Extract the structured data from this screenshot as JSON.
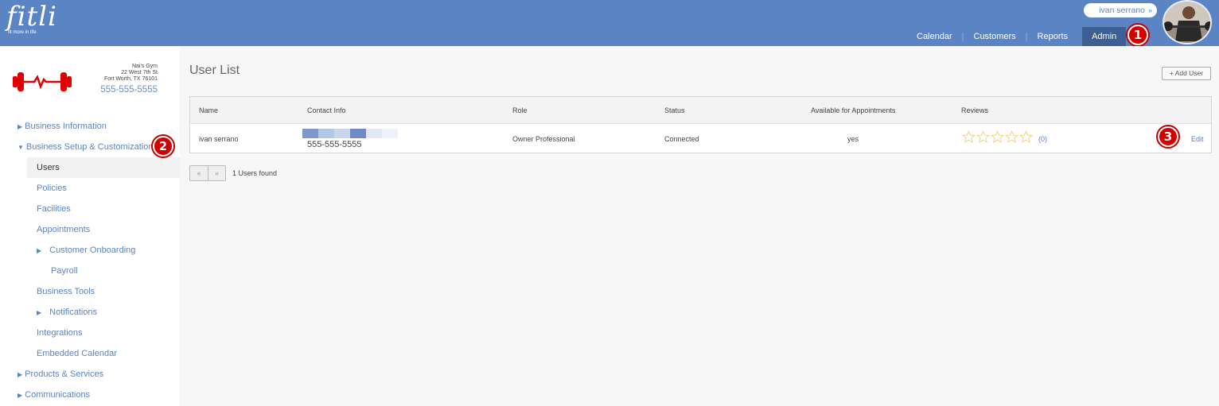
{
  "brand": {
    "logo": "fitli",
    "tagline": "fit more in life",
    "header_color": "#5b84c4",
    "active_nav_color": "#3e5f94"
  },
  "user_menu": {
    "name": "ivan serrano",
    "chevron": "»"
  },
  "nav": [
    {
      "label": "Calendar"
    },
    {
      "label": "Customers"
    },
    {
      "label": "Reports"
    },
    {
      "label": "Admin",
      "active": true
    }
  ],
  "callouts": [
    "1",
    "2",
    "3"
  ],
  "business": {
    "name": "Nai's Gym",
    "street": "22 West 7th St",
    "city": "Fort Worth, TX 76101",
    "phone": "555-555-5555",
    "logo_icon": "dumbbell-heartbeat-icon"
  },
  "sidebar": {
    "items": [
      {
        "label": "Business Information",
        "expand": "▶"
      },
      {
        "label": "Business Setup & Customization",
        "expand": "▼"
      },
      {
        "label": "Users",
        "active": true
      },
      {
        "label": "Policies"
      },
      {
        "label": "Facilities"
      },
      {
        "label": "Appointments"
      },
      {
        "label": "Customer Onboarding",
        "expand": "▶"
      },
      {
        "label": "Payroll"
      },
      {
        "label": "Business Tools"
      },
      {
        "label": "Notifications",
        "expand": "▶"
      },
      {
        "label": "Integrations"
      },
      {
        "label": "Embedded Calendar"
      },
      {
        "label": "Products & Services",
        "expand": "▶"
      },
      {
        "label": "Communications",
        "expand": "▶"
      }
    ]
  },
  "main": {
    "title": "User List",
    "add_user_label": "+ Add User",
    "table": {
      "columns": [
        "Name",
        "Contact Info",
        "Role",
        "Status",
        "Available for Appointments",
        "Reviews"
      ],
      "rows": [
        {
          "name": "ivan serrano",
          "contact_phone": "555-555-5555",
          "role": "Owner Professional",
          "status": "Connected",
          "available": "yes",
          "stars": 0,
          "review_count": "(0)",
          "action": "Edit"
        }
      ]
    },
    "pager": {
      "prev": "«",
      "next": "»"
    },
    "users_found": "1 Users found"
  }
}
